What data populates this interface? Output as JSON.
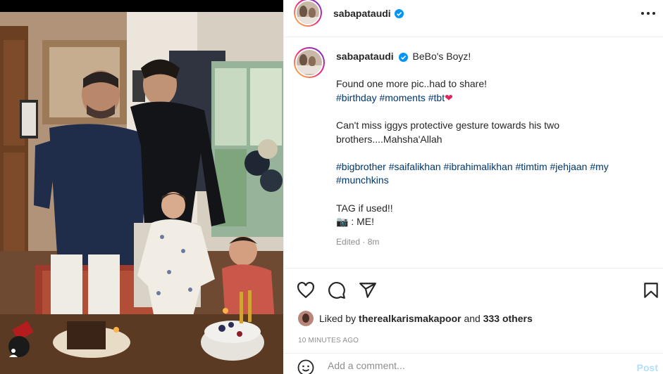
{
  "post": {
    "username": "sabapataudi",
    "caption_title": "BeBo's Boyz!",
    "line1": "Found one more pic..had to share!",
    "tags1": [
      "#birthday",
      "#moments",
      "#tbt"
    ],
    "heart_emoji": "❤",
    "line2": "Can't miss iggys protective gesture towards his two brothers....Mahsha'Allah",
    "tags2": [
      "#bigbrother",
      "#saifalikhan",
      "#ibrahimalikhan",
      "#timtim",
      "#jehjaan",
      "#my",
      "#munchkins"
    ],
    "line3": "TAG if used!!",
    "camera_emoji": "📷",
    "line4": " : ME!",
    "meta": "Edited · 8m"
  },
  "likes": {
    "prefix": "Liked by",
    "user": "therealkarismakapoor",
    "and": "and",
    "others": "333 others"
  },
  "timestamp": "10 MINUTES AGO",
  "comment": {
    "placeholder": "Add a comment...",
    "post_label": "Post"
  },
  "colors": {
    "link": "#00376b",
    "verified": "#0095f6",
    "post_disabled": "#b2dffc",
    "heart": "#e0245e"
  }
}
